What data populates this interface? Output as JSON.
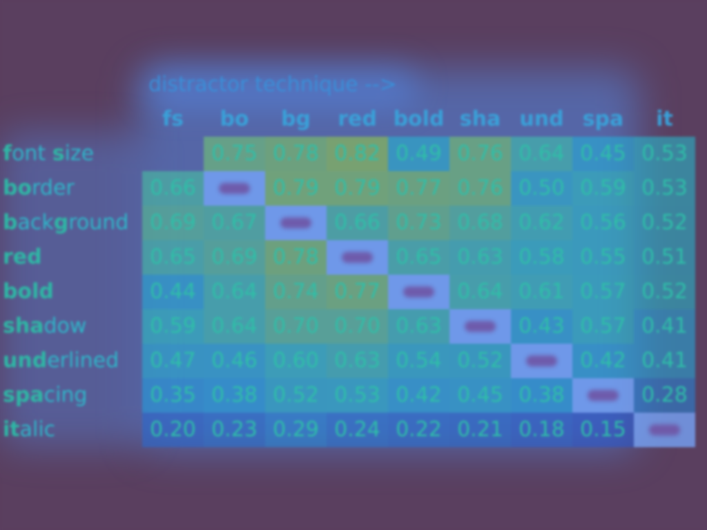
{
  "chart_data": {
    "type": "heatmap",
    "title": "distractor technique -->",
    "columns": [
      "fs",
      "bo",
      "bg",
      "red",
      "bold",
      "sha",
      "und",
      "spa",
      "it"
    ],
    "rows": [
      {
        "label": "font size",
        "bold_parts": [
          "f",
          "s"
        ],
        "values": [
          null,
          0.75,
          0.78,
          0.82,
          0.49,
          0.76,
          0.64,
          0.45,
          0.53
        ]
      },
      {
        "label": "border",
        "bold_parts": [
          "bo"
        ],
        "values": [
          0.66,
          null,
          0.79,
          0.79,
          0.77,
          0.76,
          0.5,
          0.59,
          0.53
        ]
      },
      {
        "label": "background",
        "bold_parts": [
          "b",
          "g"
        ],
        "values": [
          0.69,
          0.67,
          null,
          0.66,
          0.73,
          0.68,
          0.62,
          0.56,
          0.52
        ]
      },
      {
        "label": "red",
        "bold_parts": [
          "red"
        ],
        "values": [
          0.65,
          0.69,
          0.78,
          null,
          0.65,
          0.63,
          0.58,
          0.55,
          0.51
        ]
      },
      {
        "label": "bold",
        "bold_parts": [
          "bold"
        ],
        "values": [
          0.44,
          0.64,
          0.74,
          0.77,
          null,
          0.64,
          0.61,
          0.57,
          0.52
        ]
      },
      {
        "label": "shadow",
        "bold_parts": [
          "sha"
        ],
        "values": [
          0.59,
          0.64,
          0.7,
          0.7,
          0.63,
          null,
          0.43,
          0.57,
          0.41
        ]
      },
      {
        "label": "underlined",
        "bold_parts": [
          "und"
        ],
        "values": [
          0.47,
          0.46,
          0.6,
          0.63,
          0.54,
          0.52,
          null,
          0.42,
          0.41
        ]
      },
      {
        "label": "spacing",
        "bold_parts": [
          "spa"
        ],
        "values": [
          0.35,
          0.38,
          0.52,
          0.53,
          0.42,
          0.45,
          0.38,
          null,
          0.28
        ]
      },
      {
        "label": "italic",
        "bold_parts": [
          "it"
        ],
        "values": [
          0.2,
          0.23,
          0.29,
          0.24,
          0.22,
          0.21,
          0.18,
          0.15,
          null
        ]
      }
    ],
    "diagonal_empty": true,
    "colors": {
      "background": "#5a3f5f",
      "text": "#2fbfa8",
      "low": "#2a6fdc",
      "high": "#9bd24a"
    }
  }
}
